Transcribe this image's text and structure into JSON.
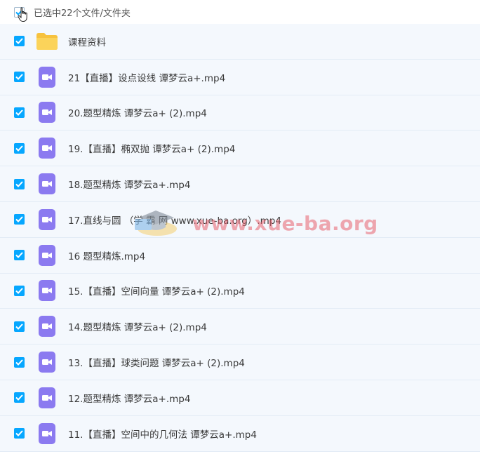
{
  "header": {
    "selection_text": "已选中22个文件/文件夹"
  },
  "files": [
    {
      "name": "课程资料",
      "type": "folder"
    },
    {
      "name": "21【直播】设点设线 谭梦云a+.mp4",
      "type": "video"
    },
    {
      "name": "20.题型精炼 谭梦云a+ (2).mp4",
      "type": "video"
    },
    {
      "name": "19.【直播】椭双抛 谭梦云a+ (2).mp4",
      "type": "video"
    },
    {
      "name": "18.题型精炼 谭梦云a+.mp4",
      "type": "video"
    },
    {
      "name": "17.直线与圆 （学 霸 网 www.xue-ba.org）.mp4",
      "type": "video"
    },
    {
      "name": "16 题型精炼.mp4",
      "type": "video"
    },
    {
      "name": "15.【直播】空间向量 谭梦云a+ (2).mp4",
      "type": "video"
    },
    {
      "name": "14.题型精炼 谭梦云a+ (2).mp4",
      "type": "video"
    },
    {
      "name": "13.【直播】球类问题 谭梦云a+ (2).mp4",
      "type": "video"
    },
    {
      "name": "12.题型精炼 谭梦云a+.mp4",
      "type": "video"
    },
    {
      "name": "11.【直播】空间中的几何法 谭梦云a+.mp4",
      "type": "video"
    }
  ],
  "watermark": {
    "text": "www.xue-ba.org"
  },
  "colors": {
    "checkbox": "#06a7ff",
    "video_icon": "#8b7af0",
    "folder_icon": "#f7c23e",
    "row_bg": "#f4f8fd"
  }
}
